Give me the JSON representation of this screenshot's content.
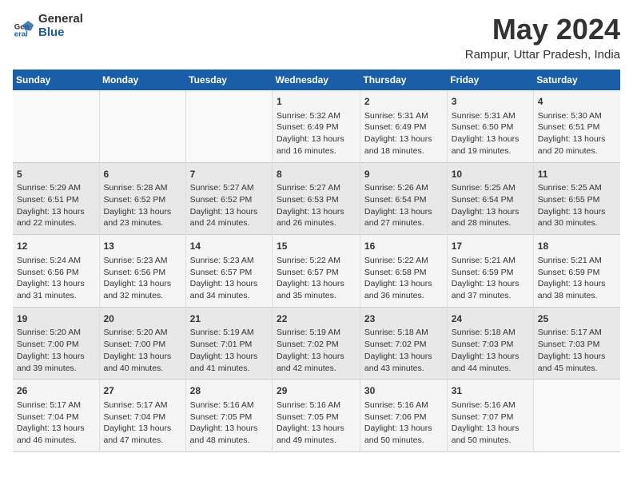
{
  "header": {
    "logo_general": "General",
    "logo_blue": "Blue",
    "month": "May 2024",
    "location": "Rampur, Uttar Pradesh, India"
  },
  "days_of_week": [
    "Sunday",
    "Monday",
    "Tuesday",
    "Wednesday",
    "Thursday",
    "Friday",
    "Saturday"
  ],
  "weeks": [
    [
      {
        "day": "",
        "info": ""
      },
      {
        "day": "",
        "info": ""
      },
      {
        "day": "",
        "info": ""
      },
      {
        "day": "1",
        "info": "Sunrise: 5:32 AM\nSunset: 6:49 PM\nDaylight: 13 hours and 16 minutes."
      },
      {
        "day": "2",
        "info": "Sunrise: 5:31 AM\nSunset: 6:49 PM\nDaylight: 13 hours and 18 minutes."
      },
      {
        "day": "3",
        "info": "Sunrise: 5:31 AM\nSunset: 6:50 PM\nDaylight: 13 hours and 19 minutes."
      },
      {
        "day": "4",
        "info": "Sunrise: 5:30 AM\nSunset: 6:51 PM\nDaylight: 13 hours and 20 minutes."
      }
    ],
    [
      {
        "day": "5",
        "info": "Sunrise: 5:29 AM\nSunset: 6:51 PM\nDaylight: 13 hours and 22 minutes."
      },
      {
        "day": "6",
        "info": "Sunrise: 5:28 AM\nSunset: 6:52 PM\nDaylight: 13 hours and 23 minutes."
      },
      {
        "day": "7",
        "info": "Sunrise: 5:27 AM\nSunset: 6:52 PM\nDaylight: 13 hours and 24 minutes."
      },
      {
        "day": "8",
        "info": "Sunrise: 5:27 AM\nSunset: 6:53 PM\nDaylight: 13 hours and 26 minutes."
      },
      {
        "day": "9",
        "info": "Sunrise: 5:26 AM\nSunset: 6:54 PM\nDaylight: 13 hours and 27 minutes."
      },
      {
        "day": "10",
        "info": "Sunrise: 5:25 AM\nSunset: 6:54 PM\nDaylight: 13 hours and 28 minutes."
      },
      {
        "day": "11",
        "info": "Sunrise: 5:25 AM\nSunset: 6:55 PM\nDaylight: 13 hours and 30 minutes."
      }
    ],
    [
      {
        "day": "12",
        "info": "Sunrise: 5:24 AM\nSunset: 6:56 PM\nDaylight: 13 hours and 31 minutes."
      },
      {
        "day": "13",
        "info": "Sunrise: 5:23 AM\nSunset: 6:56 PM\nDaylight: 13 hours and 32 minutes."
      },
      {
        "day": "14",
        "info": "Sunrise: 5:23 AM\nSunset: 6:57 PM\nDaylight: 13 hours and 34 minutes."
      },
      {
        "day": "15",
        "info": "Sunrise: 5:22 AM\nSunset: 6:57 PM\nDaylight: 13 hours and 35 minutes."
      },
      {
        "day": "16",
        "info": "Sunrise: 5:22 AM\nSunset: 6:58 PM\nDaylight: 13 hours and 36 minutes."
      },
      {
        "day": "17",
        "info": "Sunrise: 5:21 AM\nSunset: 6:59 PM\nDaylight: 13 hours and 37 minutes."
      },
      {
        "day": "18",
        "info": "Sunrise: 5:21 AM\nSunset: 6:59 PM\nDaylight: 13 hours and 38 minutes."
      }
    ],
    [
      {
        "day": "19",
        "info": "Sunrise: 5:20 AM\nSunset: 7:00 PM\nDaylight: 13 hours and 39 minutes."
      },
      {
        "day": "20",
        "info": "Sunrise: 5:20 AM\nSunset: 7:00 PM\nDaylight: 13 hours and 40 minutes."
      },
      {
        "day": "21",
        "info": "Sunrise: 5:19 AM\nSunset: 7:01 PM\nDaylight: 13 hours and 41 minutes."
      },
      {
        "day": "22",
        "info": "Sunrise: 5:19 AM\nSunset: 7:02 PM\nDaylight: 13 hours and 42 minutes."
      },
      {
        "day": "23",
        "info": "Sunrise: 5:18 AM\nSunset: 7:02 PM\nDaylight: 13 hours and 43 minutes."
      },
      {
        "day": "24",
        "info": "Sunrise: 5:18 AM\nSunset: 7:03 PM\nDaylight: 13 hours and 44 minutes."
      },
      {
        "day": "25",
        "info": "Sunrise: 5:17 AM\nSunset: 7:03 PM\nDaylight: 13 hours and 45 minutes."
      }
    ],
    [
      {
        "day": "26",
        "info": "Sunrise: 5:17 AM\nSunset: 7:04 PM\nDaylight: 13 hours and 46 minutes."
      },
      {
        "day": "27",
        "info": "Sunrise: 5:17 AM\nSunset: 7:04 PM\nDaylight: 13 hours and 47 minutes."
      },
      {
        "day": "28",
        "info": "Sunrise: 5:16 AM\nSunset: 7:05 PM\nDaylight: 13 hours and 48 minutes."
      },
      {
        "day": "29",
        "info": "Sunrise: 5:16 AM\nSunset: 7:05 PM\nDaylight: 13 hours and 49 minutes."
      },
      {
        "day": "30",
        "info": "Sunrise: 5:16 AM\nSunset: 7:06 PM\nDaylight: 13 hours and 50 minutes."
      },
      {
        "day": "31",
        "info": "Sunrise: 5:16 AM\nSunset: 7:07 PM\nDaylight: 13 hours and 50 minutes."
      },
      {
        "day": "",
        "info": ""
      }
    ]
  ]
}
